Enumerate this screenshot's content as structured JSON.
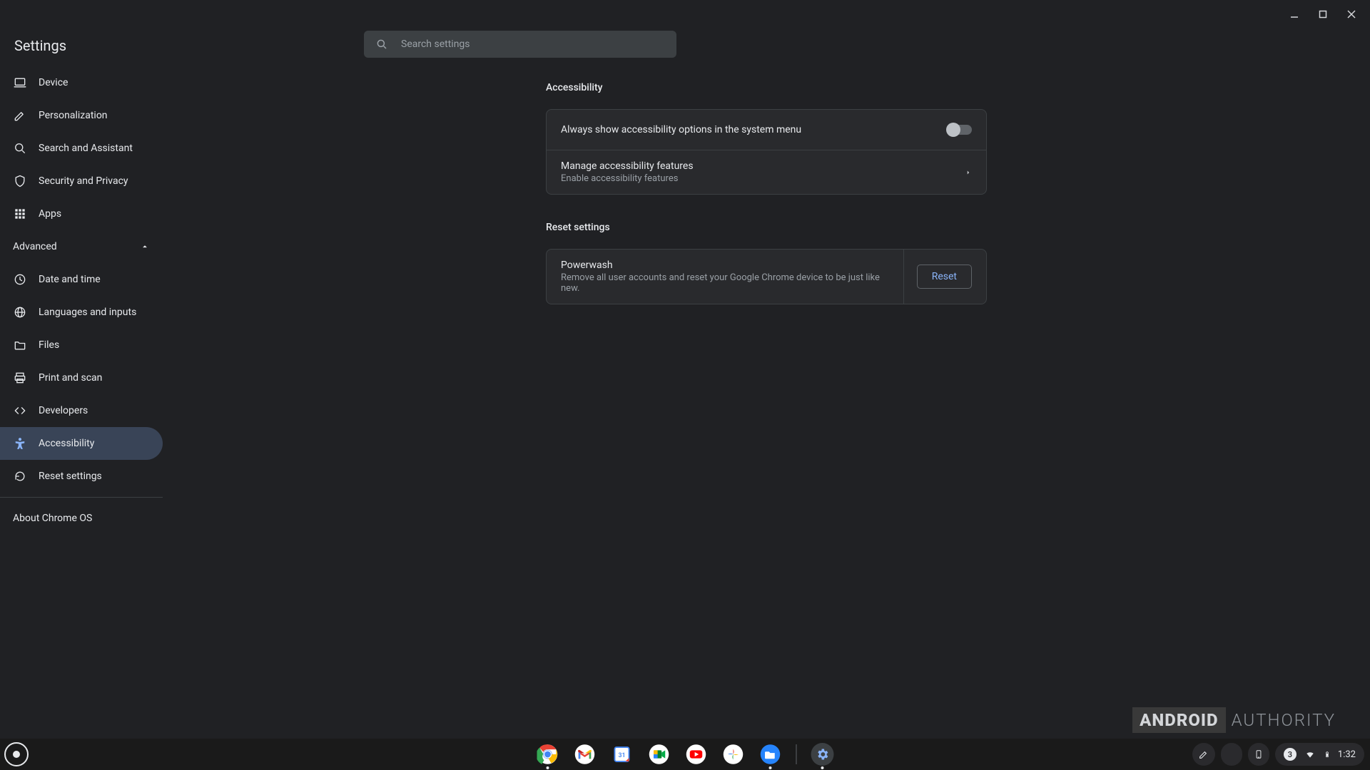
{
  "app_title": "Settings",
  "search": {
    "placeholder": "Search settings"
  },
  "sidebar": {
    "items": [
      {
        "label": "Device"
      },
      {
        "label": "Personalization"
      },
      {
        "label": "Search and Assistant"
      },
      {
        "label": "Security and Privacy"
      },
      {
        "label": "Apps"
      }
    ],
    "advanced_label": "Advanced",
    "advanced_items": [
      {
        "label": "Date and time"
      },
      {
        "label": "Languages and inputs"
      },
      {
        "label": "Files"
      },
      {
        "label": "Print and scan"
      },
      {
        "label": "Developers"
      },
      {
        "label": "Accessibility"
      },
      {
        "label": "Reset settings"
      }
    ],
    "about_label": "About Chrome OS"
  },
  "content": {
    "accessibility": {
      "title": "Accessibility",
      "toggle_label": "Always show accessibility options in the system menu",
      "manage_primary": "Manage accessibility features",
      "manage_secondary": "Enable accessibility features"
    },
    "reset": {
      "title": "Reset settings",
      "powerwash_primary": "Powerwash",
      "powerwash_secondary": "Remove all user accounts and reset your Google Chrome device to be just like new.",
      "button_label": "Reset"
    }
  },
  "shelf": {
    "notification_count": "3"
  },
  "status": {
    "clock": "1:32"
  },
  "watermark": {
    "brand_box": "ANDROID",
    "brand_text": "AUTHORITY"
  }
}
